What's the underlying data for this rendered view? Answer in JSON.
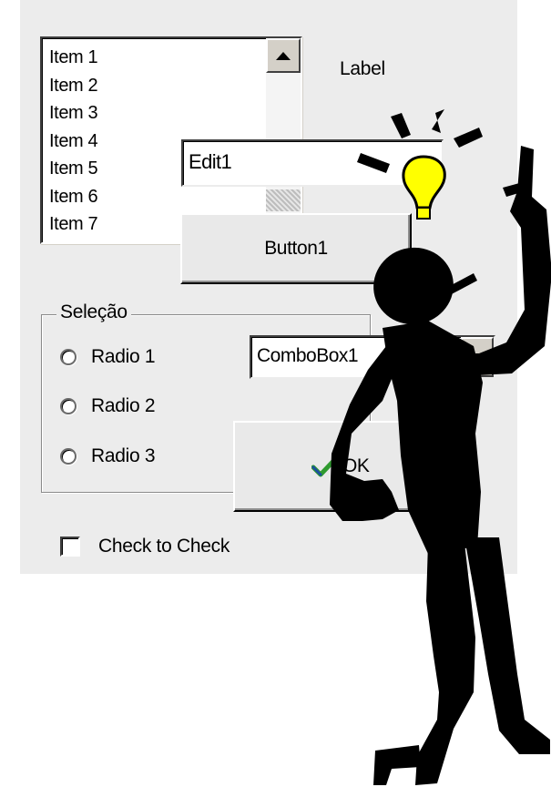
{
  "listbox": {
    "items": [
      "Item 1",
      "Item 2",
      "Item 3",
      "Item 4",
      "Item 5",
      "Item 6",
      "Item 7"
    ],
    "scroll_up_icon": "arrow-up-icon"
  },
  "label": {
    "text": "Label"
  },
  "edit": {
    "value": "Edit1"
  },
  "button1": {
    "label": "Button1"
  },
  "group": {
    "title": "Seleção",
    "radios": [
      "Radio 1",
      "Radio 2",
      "Radio 3"
    ]
  },
  "combo": {
    "value": "ComboBox1",
    "dropdown_icon": "arrow-down-icon"
  },
  "ok_button": {
    "label": "OK",
    "icon": "checkmark-icon"
  },
  "checkbox": {
    "label": "Check to Check",
    "checked": false
  },
  "illustration": {
    "subject": "stick figure pointing up with lightbulb idea",
    "bulb_color": "#ffff00"
  }
}
